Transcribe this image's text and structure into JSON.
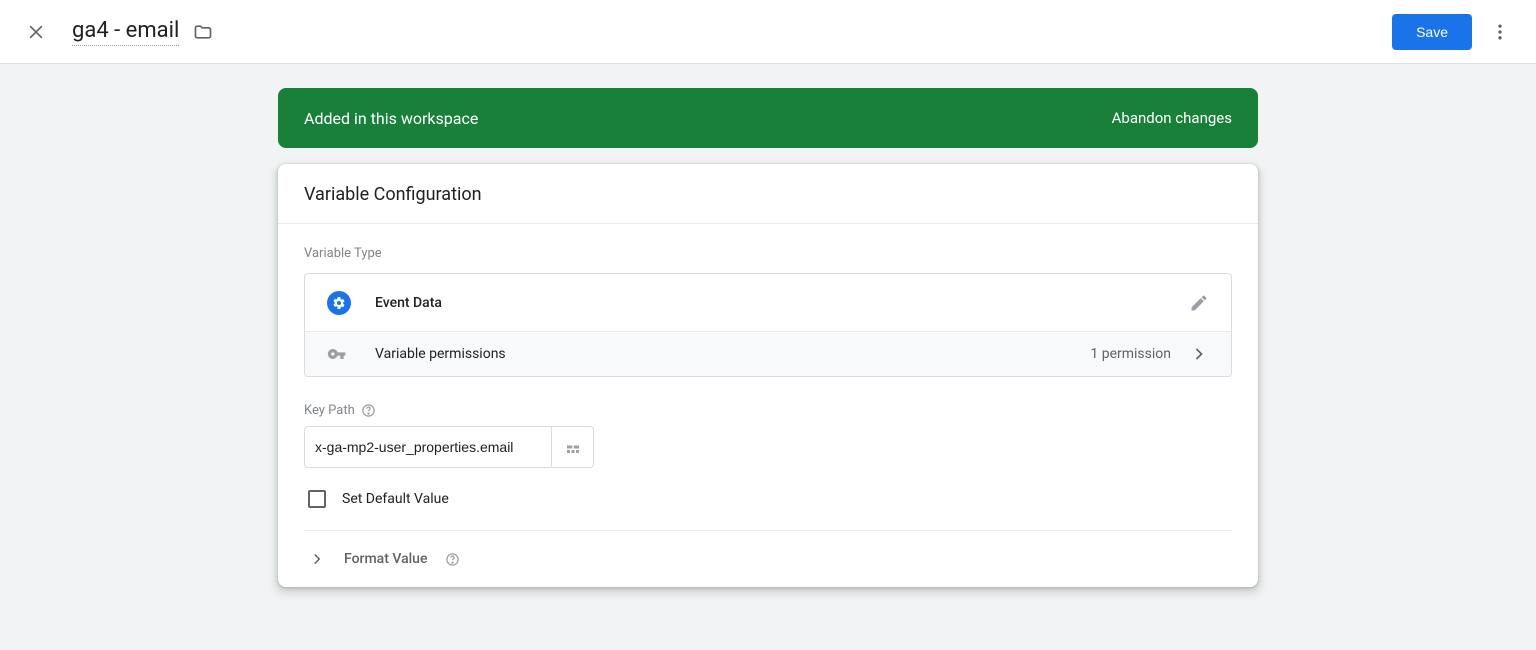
{
  "header": {
    "title": "ga4 - email",
    "save_label": "Save"
  },
  "banner": {
    "status": "Added in this workspace",
    "abandon_label": "Abandon changes"
  },
  "card": {
    "title": "Variable Configuration",
    "variable_type_label": "Variable Type",
    "type_name": "Event Data",
    "permissions_label": "Variable permissions",
    "permissions_count": "1 permission",
    "key_path_label": "Key Path",
    "key_path_value": "x-ga-mp2-user_properties.email",
    "set_default_label": "Set Default Value",
    "format_value_label": "Format Value"
  }
}
